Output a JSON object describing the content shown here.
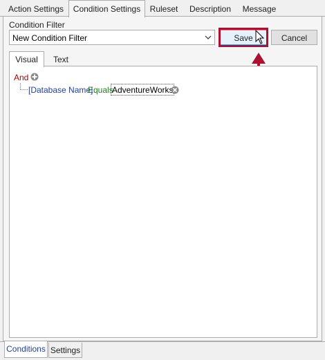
{
  "top_tabs": [
    {
      "label": "Action Settings"
    },
    {
      "label": "Condition Settings",
      "active": true
    },
    {
      "label": "Ruleset"
    },
    {
      "label": "Description"
    },
    {
      "label": "Message"
    }
  ],
  "condition_filter": {
    "label": "Condition Filter",
    "selected": "New Condition Filter"
  },
  "buttons": {
    "save": "Save",
    "cancel": "Cancel"
  },
  "editor_tabs": [
    {
      "label": "Visual",
      "active": true
    },
    {
      "label": "Text"
    }
  ],
  "condition_tree": {
    "group_operator": "And",
    "conditions": [
      {
        "field": "[Database Name]",
        "operator": "Equals",
        "value": "AdventureWorks"
      }
    ]
  },
  "bottom_tabs": [
    {
      "label": "Conditions",
      "active": true
    },
    {
      "label": "Settings"
    }
  ],
  "colors": {
    "highlight": "#b01030",
    "group_operator": "#b00000",
    "field": "#1f3f9f",
    "operator": "#1e7a1e"
  },
  "icons": {
    "add": "plus-circle-icon",
    "remove": "x-circle-icon",
    "dropdown": "chevron-down-icon",
    "pointer": "mouse-cursor-icon",
    "annotation": "red-arrow-icon"
  }
}
